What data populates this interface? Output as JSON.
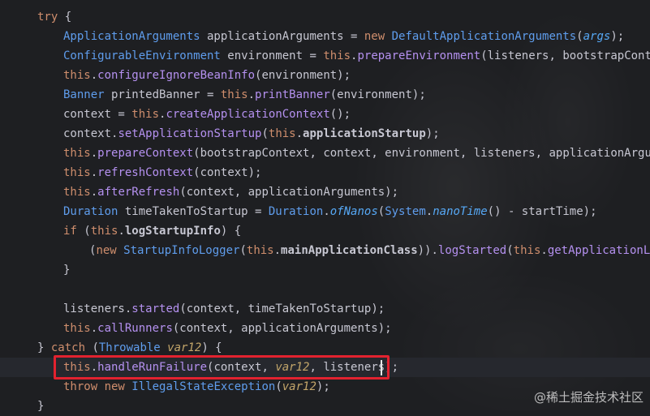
{
  "code": {
    "lines": [
      {
        "parts": [
          [
            "k",
            "try"
          ],
          [
            "t",
            " {"
          ]
        ]
      },
      {
        "parts": [
          [
            "ty",
            "ApplicationArguments"
          ],
          [
            "t",
            " applicationArguments = "
          ],
          [
            "k",
            "new "
          ],
          [
            "ty",
            "DefaultApplicationArguments"
          ],
          [
            "t",
            "("
          ],
          [
            "p",
            "args"
          ],
          [
            "t",
            ");"
          ]
        ]
      },
      {
        "parts": [
          [
            "ty",
            "ConfigurableEnvironment"
          ],
          [
            "t",
            " environment = "
          ],
          [
            "k",
            "this"
          ],
          [
            "t",
            "."
          ],
          [
            "mc",
            "prepareEnvironment"
          ],
          [
            "t",
            "(listeners, bootstrapContext,"
          ]
        ]
      },
      {
        "parts": [
          [
            "k",
            "this"
          ],
          [
            "t",
            "."
          ],
          [
            "mc",
            "configureIgnoreBeanInfo"
          ],
          [
            "t",
            "(environment);"
          ]
        ]
      },
      {
        "parts": [
          [
            "ty",
            "Banner"
          ],
          [
            "t",
            " printedBanner = "
          ],
          [
            "k",
            "this"
          ],
          [
            "t",
            "."
          ],
          [
            "mc",
            "printBanner"
          ],
          [
            "t",
            "(environment);"
          ]
        ]
      },
      {
        "parts": [
          [
            "t",
            "context = "
          ],
          [
            "k",
            "this"
          ],
          [
            "t",
            "."
          ],
          [
            "mc",
            "createApplicationContext"
          ],
          [
            "t",
            "();"
          ]
        ]
      },
      {
        "parts": [
          [
            "t",
            "context."
          ],
          [
            "mc",
            "setApplicationStartup"
          ],
          [
            "t",
            "("
          ],
          [
            "k",
            "this"
          ],
          [
            "t",
            "."
          ],
          [
            "b",
            "applicationStartup"
          ],
          [
            "t",
            ");"
          ]
        ]
      },
      {
        "parts": [
          [
            "k",
            "this"
          ],
          [
            "t",
            "."
          ],
          [
            "mc",
            "prepareContext"
          ],
          [
            "t",
            "(bootstrapContext, context, environment, listeners, applicationArguments"
          ]
        ]
      },
      {
        "parts": [
          [
            "k",
            "this"
          ],
          [
            "t",
            "."
          ],
          [
            "mc",
            "refreshContext"
          ],
          [
            "t",
            "(context);"
          ]
        ]
      },
      {
        "parts": [
          [
            "k",
            "this"
          ],
          [
            "t",
            "."
          ],
          [
            "mc",
            "afterRefresh"
          ],
          [
            "t",
            "(context, applicationArguments);"
          ]
        ]
      },
      {
        "parts": [
          [
            "ty",
            "Duration"
          ],
          [
            "t",
            " timeTakenToStartup = "
          ],
          [
            "ty",
            "Duration"
          ],
          [
            "t",
            "."
          ],
          [
            "p",
            "ofNanos"
          ],
          [
            "t",
            "("
          ],
          [
            "ty",
            "System"
          ],
          [
            "t",
            "."
          ],
          [
            "p",
            "nanoTime"
          ],
          [
            "t",
            "() - startTime);"
          ]
        ]
      },
      {
        "parts": [
          [
            "k",
            "if"
          ],
          [
            "t",
            " ("
          ],
          [
            "k",
            "this"
          ],
          [
            "t",
            "."
          ],
          [
            "b",
            "logStartupInfo"
          ],
          [
            "t",
            ") {"
          ]
        ]
      },
      {
        "parts": [
          [
            "t",
            "("
          ],
          [
            "k",
            "new "
          ],
          [
            "ty",
            "StartupInfoLogger"
          ],
          [
            "t",
            "("
          ],
          [
            "k",
            "this"
          ],
          [
            "t",
            "."
          ],
          [
            "b",
            "mainApplicationClass"
          ],
          [
            "t",
            "))."
          ],
          [
            "mc",
            "logStarted"
          ],
          [
            "t",
            "("
          ],
          [
            "k",
            "this"
          ],
          [
            "t",
            "."
          ],
          [
            "mc",
            "getApplicationLog"
          ],
          [
            "t",
            "(),"
          ]
        ]
      },
      {
        "parts": [
          [
            "t",
            "}"
          ]
        ]
      },
      {
        "parts": []
      },
      {
        "parts": [
          [
            "t",
            "listeners."
          ],
          [
            "mc",
            "started"
          ],
          [
            "t",
            "(context, timeTakenToStartup);"
          ]
        ]
      },
      {
        "parts": [
          [
            "k",
            "this"
          ],
          [
            "t",
            "."
          ],
          [
            "mc",
            "callRunners"
          ],
          [
            "t",
            "(context, applicationArguments);"
          ]
        ]
      },
      {
        "parts": [
          [
            "t",
            "} "
          ],
          [
            "k",
            "catch"
          ],
          [
            "t",
            " ("
          ],
          [
            "ty",
            "Throwable"
          ],
          [
            "t",
            " "
          ],
          [
            "v",
            "var12"
          ],
          [
            "t",
            ") {"
          ]
        ]
      },
      {
        "parts": [
          [
            "k",
            "this"
          ],
          [
            "t",
            "."
          ],
          [
            "mc",
            "handleRunFailure"
          ],
          [
            "t",
            "(context, "
          ],
          [
            "v",
            "var12"
          ],
          [
            "t",
            ", listeners);"
          ]
        ]
      },
      {
        "parts": [
          [
            "k",
            "throw new "
          ],
          [
            "ty",
            "IllegalStateException"
          ],
          [
            "t",
            "("
          ],
          [
            "v",
            "var12"
          ],
          [
            "t",
            ");"
          ]
        ]
      },
      {
        "parts": [
          [
            "t",
            "}"
          ]
        ]
      }
    ],
    "indent": [
      1,
      2,
      2,
      2,
      2,
      2,
      2,
      2,
      2,
      2,
      2,
      2,
      3,
      2,
      0,
      2,
      2,
      1,
      2,
      2,
      1
    ]
  },
  "watermark": "@稀土掘金技术社区"
}
